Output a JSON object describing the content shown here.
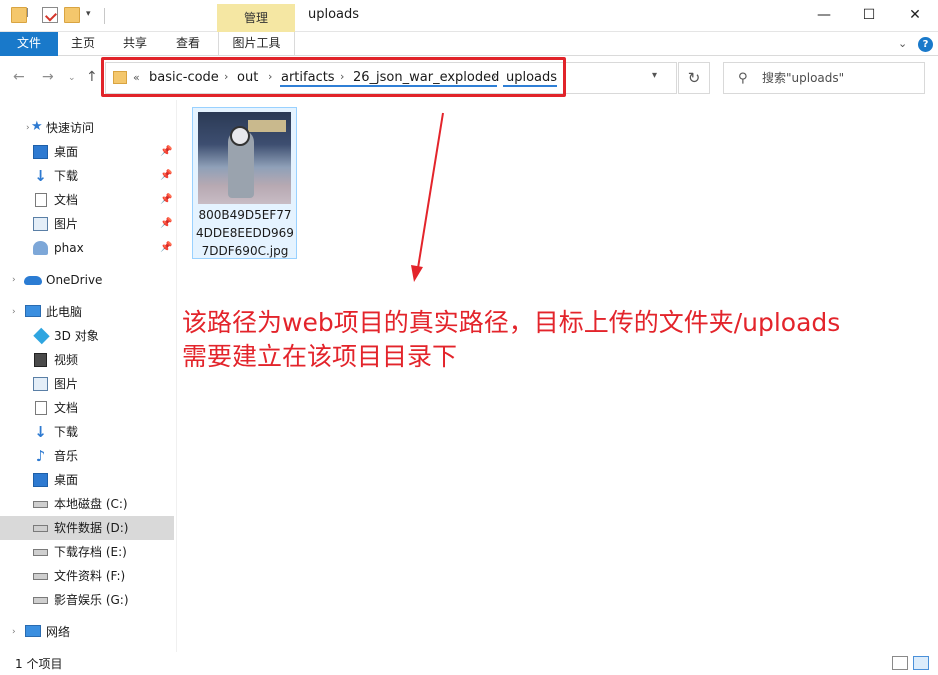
{
  "window": {
    "title": "uploads",
    "manage_tab": "管理",
    "minimize": "—",
    "maximize": "☐",
    "close": "✕"
  },
  "ribbon": {
    "tabs": [
      "文件",
      "主页",
      "共享",
      "查看",
      "图片工具"
    ],
    "expand_icon": "chevron-down-icon",
    "help_label": "?"
  },
  "address": {
    "overflow": "«",
    "crumbs": [
      "basic-code",
      "out",
      "artifacts",
      "26_json_war_exploded",
      "uploads"
    ],
    "separator": "›"
  },
  "search": {
    "placeholder": "搜索\"uploads\""
  },
  "sidebar": {
    "quick_access": "快速访问",
    "quick_items": [
      "桌面",
      "下载",
      "文档",
      "图片",
      "phax"
    ],
    "onedrive": "OneDrive",
    "this_pc": "此电脑",
    "pc_items": [
      "3D 对象",
      "视频",
      "图片",
      "文档",
      "下载",
      "音乐",
      "桌面",
      "本地磁盘 (C:)",
      "软件数据 (D:)",
      "下载存档 (E:)",
      "文件资料 (F:)",
      "影音娱乐 (G:)"
    ],
    "network": "网络"
  },
  "files": [
    {
      "name": "800B49D5EF774DDE8EEDD9697DDF690C.jpg",
      "type": "jpg-thumbnail"
    }
  ],
  "annotation": {
    "line1": "该路径为web项目的真实路径，目标上传的文件夹/uploads",
    "line2": "需要建立在该项目目录下",
    "color": "#e3242b"
  },
  "status": {
    "item_count": "1 个项目"
  },
  "colors": {
    "accent": "#1979ca",
    "manage_tab": "#f5e7a3",
    "highlight": "#e1242a",
    "selected_file": "#e5f3ff"
  }
}
